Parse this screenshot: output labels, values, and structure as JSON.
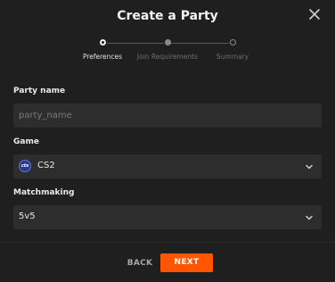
{
  "dialog": {
    "title": "Create a Party",
    "close_icon": "close-icon"
  },
  "stepper": {
    "steps": [
      {
        "label": "Preferences",
        "state": "active"
      },
      {
        "label": "Join Requirements",
        "state": "completed"
      },
      {
        "label": "Summary",
        "state": "pending"
      }
    ]
  },
  "form": {
    "party_name": {
      "label": "Party name",
      "placeholder": "party_name",
      "value": ""
    },
    "game": {
      "label": "Game",
      "value": "CS2",
      "icon": "cs2-game-icon",
      "icon_text": "cts"
    },
    "matchmaking": {
      "label": "Matchmaking",
      "value": "5v5"
    }
  },
  "footer": {
    "back_label": "BACK",
    "next_label": "NEXT"
  },
  "colors": {
    "background": "#1f1f1f",
    "field": "#2d2d2d",
    "accent": "#ff5500"
  }
}
